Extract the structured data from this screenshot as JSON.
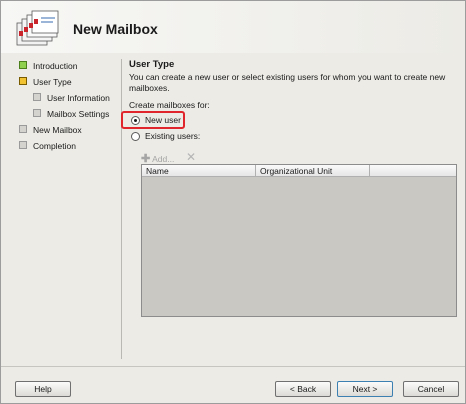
{
  "header": {
    "title": "New Mailbox",
    "icon": "mailbox-stack-icon"
  },
  "nav": {
    "items": [
      {
        "label": "Introduction",
        "state": "done",
        "level": 0
      },
      {
        "label": "User Type",
        "state": "current",
        "level": 0
      },
      {
        "label": "User Information",
        "state": "pending",
        "level": 1
      },
      {
        "label": "Mailbox Settings",
        "state": "pending",
        "level": 1
      },
      {
        "label": "New Mailbox",
        "state": "pending",
        "level": 0
      },
      {
        "label": "Completion",
        "state": "pending",
        "level": 0
      }
    ]
  },
  "main": {
    "title": "User Type",
    "description": "You can create a new user or select existing users for whom you want to create new mailboxes.",
    "create_for_label": "Create mailboxes for:",
    "options": [
      {
        "label": "New user",
        "selected": true
      },
      {
        "label": "Existing users:",
        "selected": false
      }
    ],
    "toolbar": {
      "add_label": "Add...",
      "add_icon": "add-plus-icon",
      "remove_icon": "remove-x-icon"
    },
    "grid": {
      "columns": [
        "Name",
        "Organizational Unit"
      ]
    }
  },
  "footer": {
    "help": "Help",
    "back": "< Back",
    "next": "Next >",
    "cancel": "Cancel"
  },
  "colors": {
    "highlight": "#e0262c",
    "done": "#8fd14f",
    "current": "#f1c232",
    "background": "#ecebe6"
  }
}
